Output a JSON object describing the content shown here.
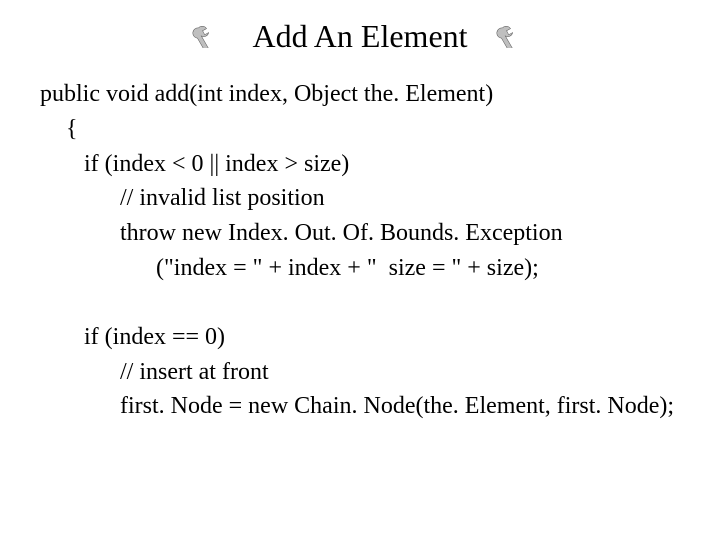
{
  "title": "Add An Element",
  "code": {
    "l0": "public void add(int index, Object the. Element)",
    "l1": " {",
    "l2": "if (index < 0 || index > size)",
    "l3": "// invalid list position",
    "l4": "throw new Index. Out. Of. Bounds. Exception",
    "l5": "(\"index = \" + index + \"  size = \" + size);",
    "l6": "if (index == 0)",
    "l7": "// insert at front",
    "l8": "first. Node = new Chain. Node(the. Element, first. Node);"
  }
}
